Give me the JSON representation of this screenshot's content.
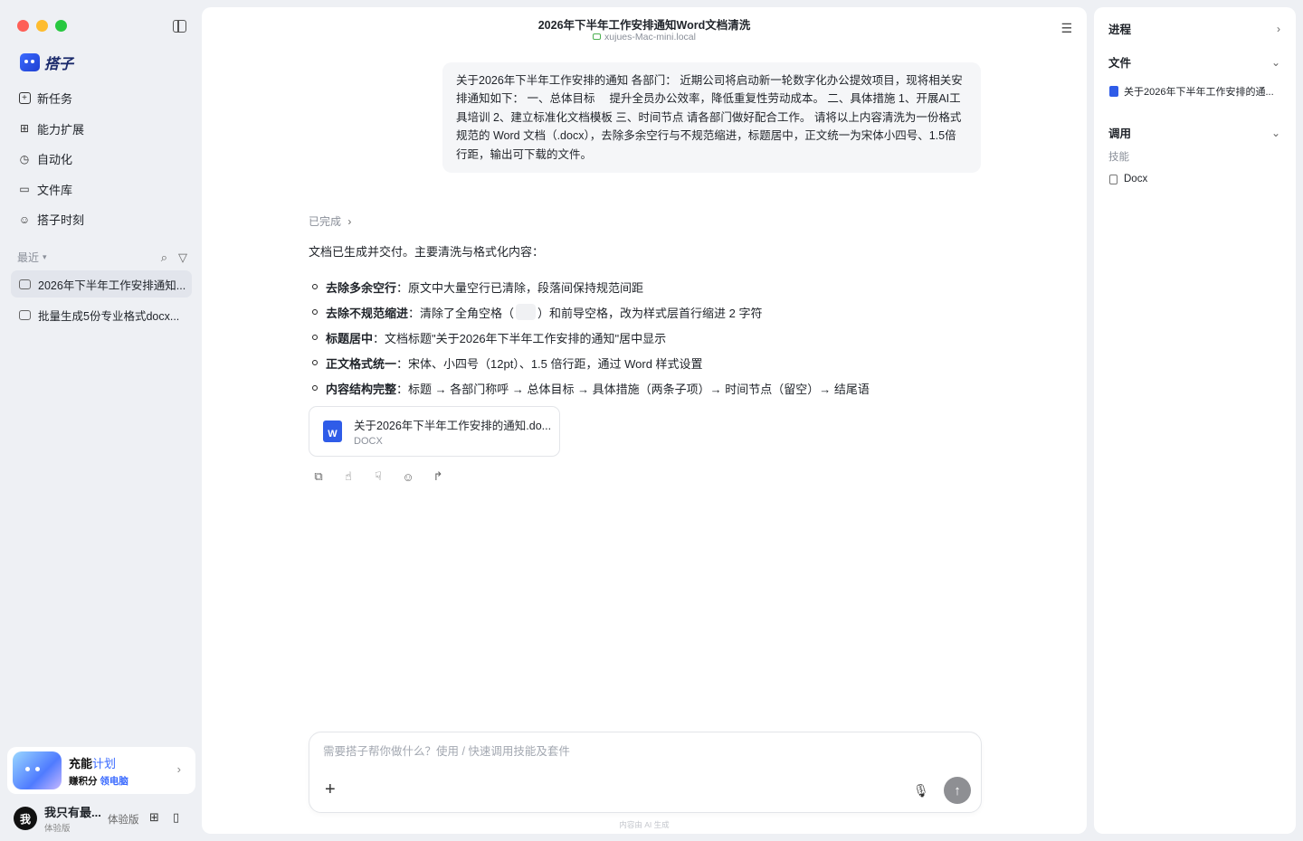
{
  "sidebar": {
    "brand": "搭子",
    "nav": [
      {
        "label": "新任务",
        "icon": "plus-square-icon"
      },
      {
        "label": "能力扩展",
        "icon": "grid-plus-icon"
      },
      {
        "label": "自动化",
        "icon": "clock-icon"
      },
      {
        "label": "文件库",
        "icon": "folder-icon"
      },
      {
        "label": "搭子时刻",
        "icon": "smile-icon"
      }
    ],
    "recent_label": "最近",
    "recent": [
      {
        "title": "2026年下半年工作安排通知..."
      },
      {
        "title": "批量生成5份专业格式docx..."
      }
    ],
    "promo": {
      "title_a": "充能",
      "title_b": "计划",
      "sub_a": "赚积分 ",
      "sub_b": "领电脑"
    },
    "user": {
      "avatar": "我",
      "name": "我只有最...",
      "tier": "体验版",
      "badge": "体验版"
    }
  },
  "main": {
    "title": "2026年下半年工作安排通知Word文档清洗",
    "host": "xujues-Mac-mini.local",
    "user_message": "关于2026年下半年工作安排的通知 各部门： 近期公司将启动新一轮数字化办公提效项目，现将相关安排通知如下： 一、总体目标　 提升全员办公效率，降低重复性劳动成本。 二、具体措施 1、开展AI工具培训 2、建立标准化文档模板 三、时间节点 请各部门做好配合工作。 请将以上内容清洗为一份格式规范的 Word 文档（.docx），去除多余空行与不规范缩进，标题居中，正文统一为宋体小四号、1.5倍行距，输出可下载的文件。",
    "status": "已完成",
    "answer_intro": "文档已生成并交付。主要清洗与格式化内容：",
    "bullets": [
      {
        "bold": "去除多余空行",
        "text": "：原文中大量空行已清除，段落间保持规范间距"
      },
      {
        "bold": "去除不规范缩进",
        "text_a": "：清除了全角空格（",
        "text_b": "）和前导空格，改为样式层首行缩进 2 字符"
      },
      {
        "bold": "标题居中",
        "text": "：文档标题\"关于2026年下半年工作安排的通知\"居中显示"
      },
      {
        "bold": "正文格式统一",
        "text": "：宋体、小四号（12pt）、1.5 倍行距，通过 Word 样式设置"
      },
      {
        "bold": "内容结构完整",
        "text": "：标题 → 各部门称呼 → 总体目标 → 具体措施（两条子项）→ 时间节点（留空）→ 结尾语"
      }
    ],
    "file": {
      "name": "关于2026年下半年工作安排的通知.do...",
      "type": "DOCX",
      "icon_letter": "W"
    },
    "composer": {
      "placeholder": "需要搭子帮你做什么？使用 / 快速调用技能及套件"
    },
    "ai_note": "内容由 AI 生成"
  },
  "right": {
    "progress": "进程",
    "files": "文件",
    "file_item": "关于2026年下半年工作安排的通...",
    "invoke": "调用",
    "skills_label": "技能",
    "skill": "Docx"
  }
}
